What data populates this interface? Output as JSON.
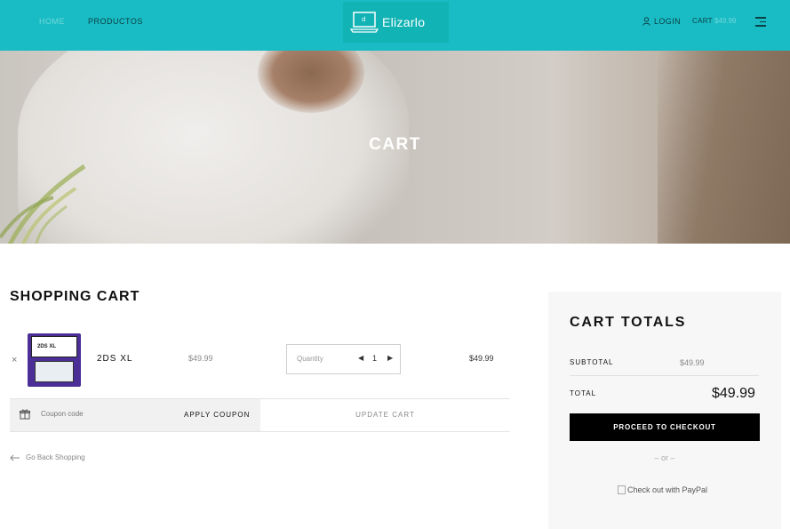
{
  "header": {
    "nav": [
      {
        "label": "HOME"
      },
      {
        "label": "PRODUCTOS"
      }
    ],
    "logo_text": "Elizarlo",
    "login_label": "LOGIN",
    "cart_label": "CART",
    "cart_amount": "$49.99",
    "colors": {
      "bar": "#19bcc4",
      "logo_bg": "#12b3b4"
    }
  },
  "hero": {
    "title": "CART"
  },
  "shopping_cart": {
    "title": "SHOPPING CART",
    "items": [
      {
        "remove_symbol": "×",
        "name": "2DS XL",
        "price": "$49.99",
        "quantity_label": "Quantity",
        "quantity": "1",
        "total": "$49.99"
      }
    ],
    "coupon_placeholder": "Coupon code",
    "apply_coupon_label": "APPLY COUPON",
    "update_cart_label": "UPDATE CART",
    "back_link_label": "Go Back Shopping"
  },
  "totals": {
    "title": "CART TOTALS",
    "subtotal_label": "SUBTOTAL",
    "subtotal_value": "$49.99",
    "total_label": "TOTAL",
    "total_value": "$49.99",
    "checkout_label": "PROCEED TO CHECKOUT",
    "or_text": "– or –",
    "paypal_alt": "Check out with PayPal"
  }
}
